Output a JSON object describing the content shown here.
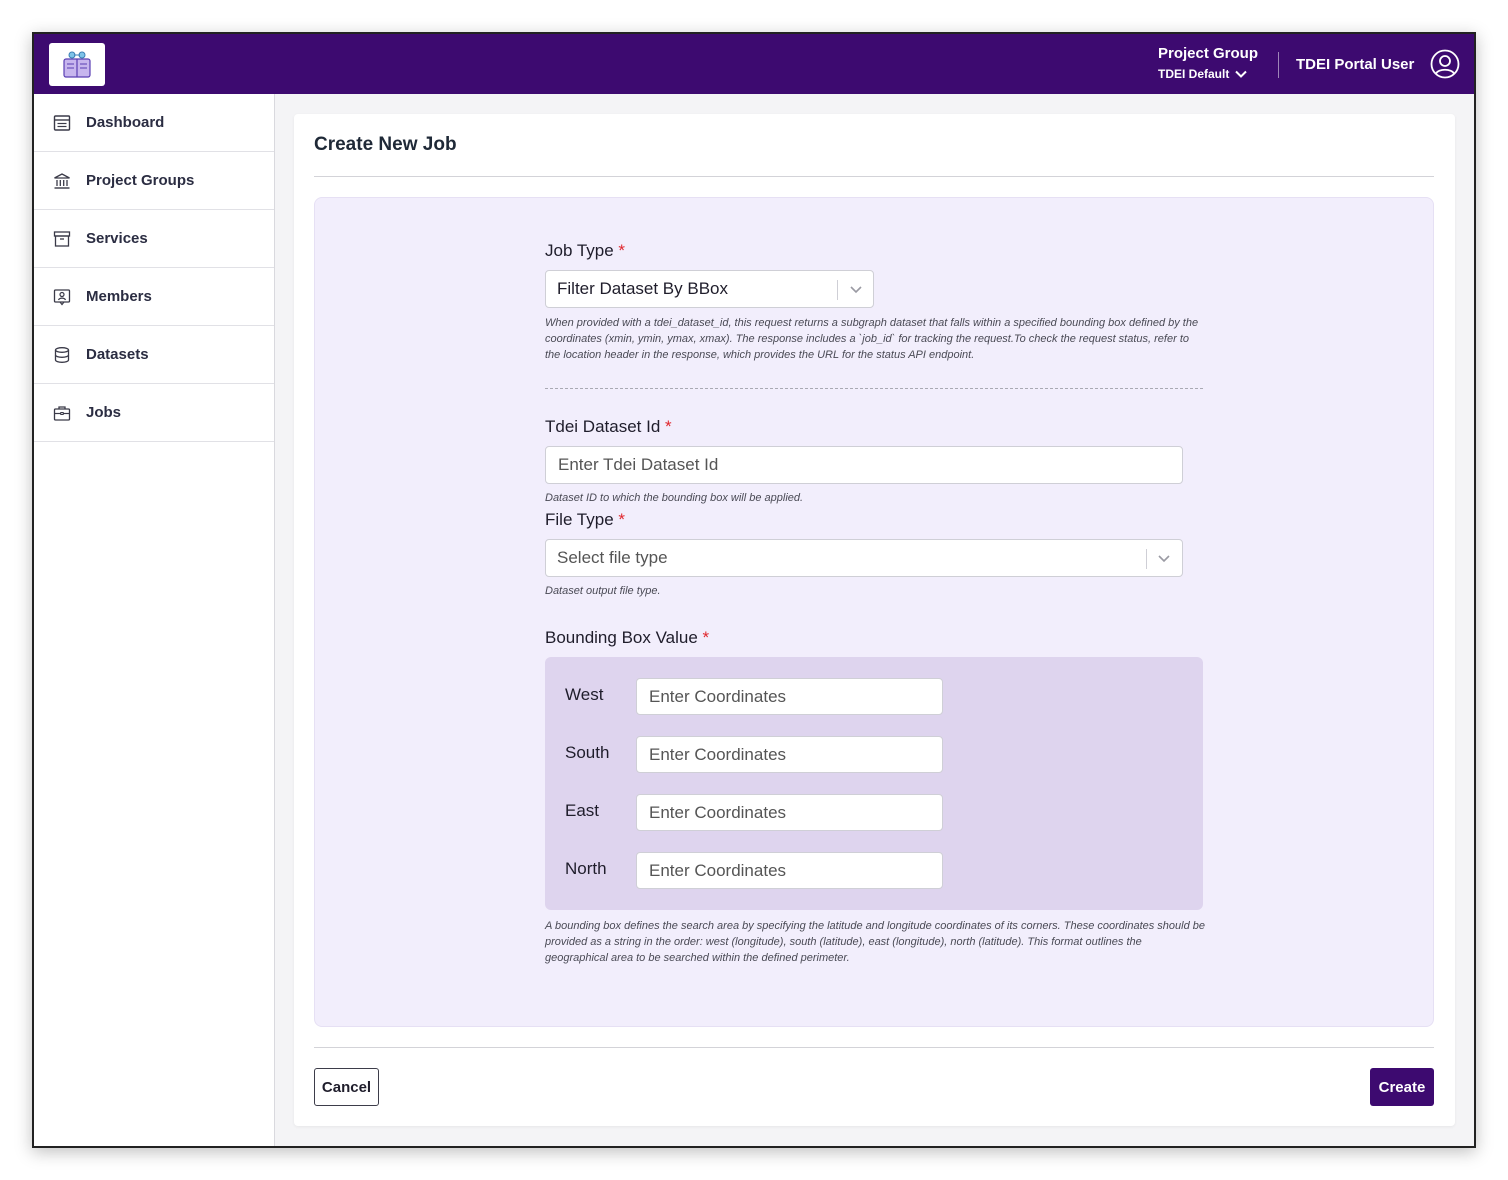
{
  "header": {
    "logo_icon": "tdei-logo-icon",
    "project_group_label": "Project Group",
    "project_group_value": "TDEI Default",
    "user_name": "TDEI Portal User",
    "user_icon": "user-circle-icon"
  },
  "sidebar": {
    "items": [
      {
        "label": "Dashboard",
        "icon": "dashboard-icon"
      },
      {
        "label": "Project Groups",
        "icon": "bank-icon"
      },
      {
        "label": "Services",
        "icon": "archive-icon"
      },
      {
        "label": "Members",
        "icon": "member-badge-icon"
      },
      {
        "label": "Datasets",
        "icon": "database-icon"
      },
      {
        "label": "Jobs",
        "icon": "briefcase-icon"
      }
    ]
  },
  "page": {
    "title": "Create New Job"
  },
  "form": {
    "job_type": {
      "label": "Job Type",
      "required_mark": "*",
      "value": "Filter Dataset By BBox",
      "help": "When provided with a tdei_dataset_id, this request returns a subgraph dataset that falls within a specified bounding box defined by the coordinates (xmin, ymin, ymax, xmax). The response includes a `job_id` for tracking the request.To check the request status, refer to the location header in the response, which provides the URL for the status API endpoint."
    },
    "dataset_id": {
      "label": "Tdei Dataset Id",
      "required_mark": "*",
      "placeholder": "Enter Tdei Dataset Id",
      "help": "Dataset ID to which the bounding box will be applied."
    },
    "file_type": {
      "label": "File Type",
      "required_mark": "*",
      "placeholder": "Select file type",
      "help": "Dataset output file type."
    },
    "bbox": {
      "label": "Bounding Box Value",
      "required_mark": "*",
      "west_label": "West",
      "south_label": "South",
      "east_label": "East",
      "north_label": "North",
      "placeholder": "Enter Coordinates",
      "help": "A bounding box defines the search area by specifying the latitude and longitude coordinates of its corners. These coordinates should be provided as a string in the order: west (longitude), south (latitude), east (longitude), north (latitude). This format outlines the geographical area to be searched within the defined perimeter."
    }
  },
  "actions": {
    "cancel_label": "Cancel",
    "create_label": "Create"
  },
  "colors": {
    "brand": "#3d0a70",
    "form_bg": "#f2eefc",
    "bbox_bg": "#ded4ee",
    "required": "#e0262c"
  }
}
